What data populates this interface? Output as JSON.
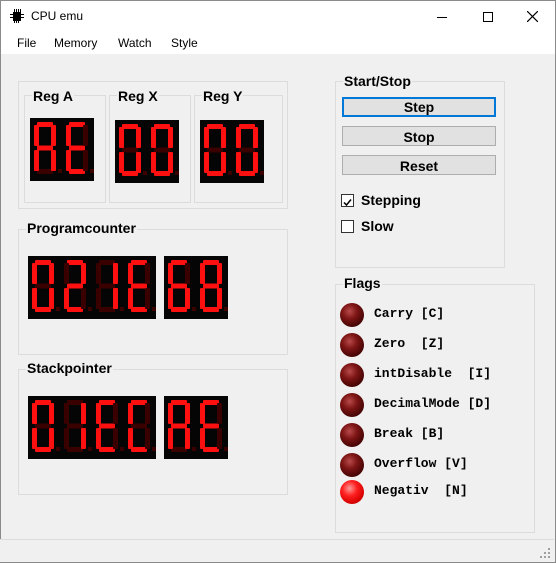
{
  "window": {
    "title": "CPU emu"
  },
  "menu": [
    "File",
    "Memory",
    "Watch",
    "Style"
  ],
  "registers": {
    "reg_a": {
      "label": "Reg A",
      "value": "AE"
    },
    "reg_x": {
      "label": "Reg X",
      "value": "00"
    },
    "reg_y": {
      "label": "Reg Y",
      "value": "00"
    }
  },
  "program_counter": {
    "label": "Programcounter",
    "high": "021E",
    "low": "68"
  },
  "stack_pointer": {
    "label": "Stackpointer",
    "high": "01EC",
    "low": "AE"
  },
  "control": {
    "title": "Start/Stop",
    "step_label": "Step",
    "stop_label": "Stop",
    "reset_label": "Reset",
    "stepping": {
      "label": "Stepping",
      "checked": true
    },
    "slow": {
      "label": "Slow",
      "checked": false
    }
  },
  "flags": {
    "title": "Flags",
    "items": [
      {
        "label": "Carry [C]",
        "on": false
      },
      {
        "label": "Zero  [Z]",
        "on": false
      },
      {
        "label": "intDisable  [I]",
        "on": false
      },
      {
        "label": "DecimalMode [D]",
        "on": false
      },
      {
        "label": "Break [B]",
        "on": false
      },
      {
        "label": "Overflow [V]",
        "on": false
      },
      {
        "label": "Negativ  [N]",
        "on": true
      }
    ]
  },
  "colors": {
    "segment_on": "#ff1010",
    "segment_off": "#3a0000",
    "led_on": "#ff2020",
    "led_off": "#7d1515",
    "focus": "#0078d7"
  }
}
